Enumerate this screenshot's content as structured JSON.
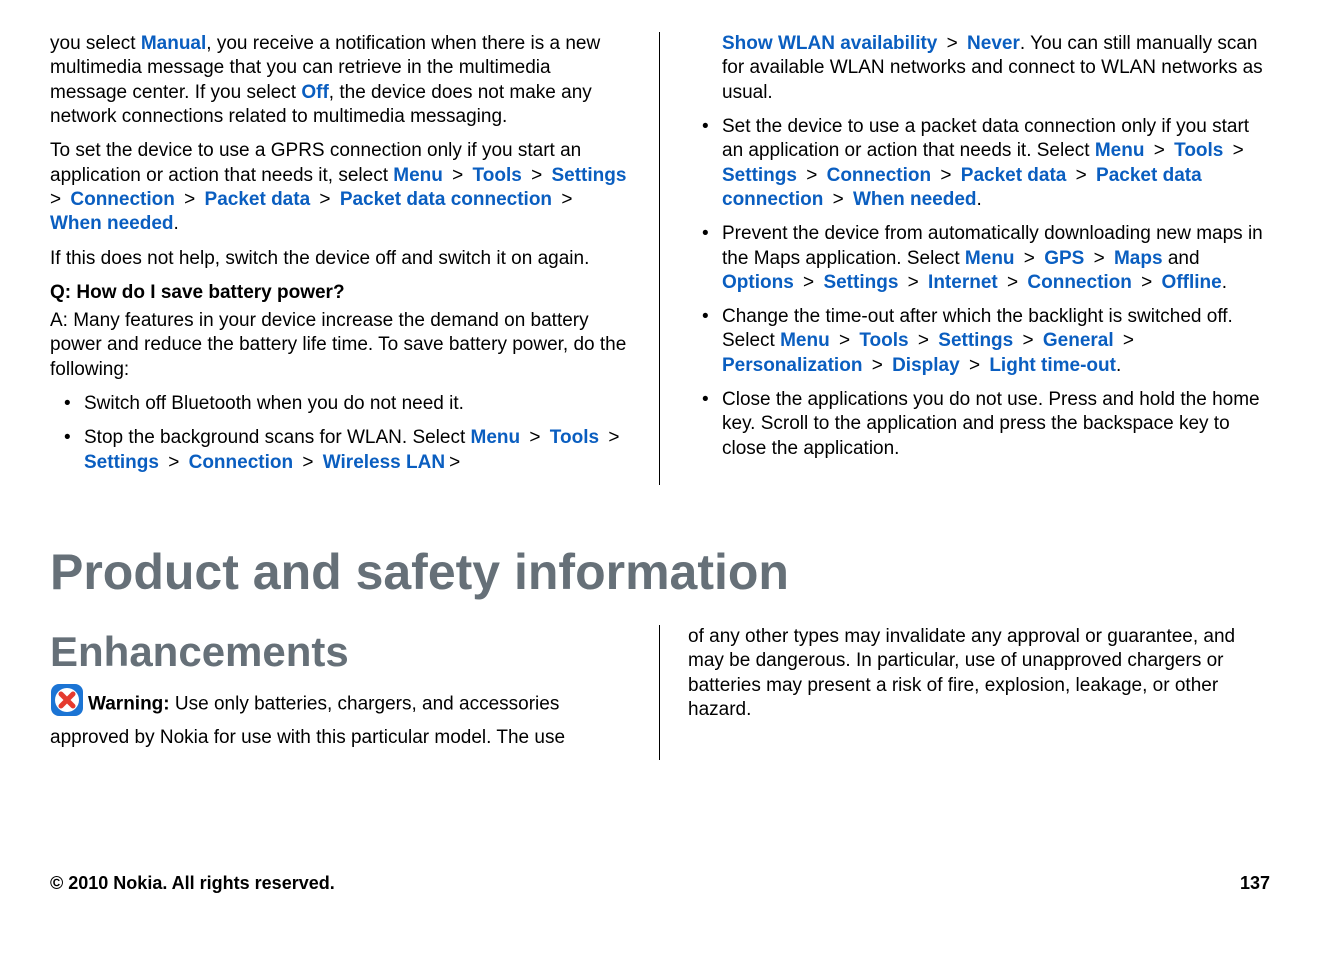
{
  "upper_left": {
    "p1_a": "you select ",
    "p1_manual": "Manual",
    "p1_b": ", you receive a notification when there is a new multimedia message that you can retrieve in the multimedia message center. If you select ",
    "p1_off": "Off",
    "p1_c": ", the device does not make any network connections related to multimedia messaging.",
    "p2_a": "To set the device to use a GPRS connection only if you start an application or action that needs it, select ",
    "p2_path": [
      "Menu",
      "Tools",
      "Settings",
      "Connection",
      "Packet data",
      "Packet data connection",
      "When needed"
    ],
    "p2_b": ".",
    "p3": "If this does not help, switch the device off and switch it on again.",
    "q": "Q: How do I save battery power?",
    "a": "A: Many features in your device increase the demand on battery power and reduce the battery life time. To save battery power, do the following:",
    "li1": "Switch off Bluetooth when you do not need it.",
    "li2_a": "Stop the background scans for WLAN. Select ",
    "li2_path": [
      "Menu",
      "Tools",
      "Settings",
      "Connection",
      "Wireless LAN"
    ]
  },
  "upper_right": {
    "cont_path": [
      "Show WLAN availability",
      "Never"
    ],
    "cont_b": ". You can still manually scan for available WLAN networks and connect to WLAN networks as usual.",
    "li3_a": "Set the device to use a packet data connection only if you start an application or action that needs it. Select ",
    "li3_path": [
      "Menu",
      "Tools",
      "Settings",
      "Connection",
      "Packet data",
      "Packet data connection",
      "When needed"
    ],
    "li3_b": ".",
    "li4_a": "Prevent the device from automatically downloading new maps in the Maps application. Select ",
    "li4_path1": [
      "Menu",
      "GPS",
      "Maps"
    ],
    "li4_and": " and ",
    "li4_path2": [
      "Options",
      "Settings",
      "Internet",
      "Connection",
      "Offline"
    ],
    "li4_b": ".",
    "li5_a": "Change the time-out after which the backlight is switched off. Select ",
    "li5_path": [
      "Menu",
      "Tools",
      "Settings",
      "General",
      "Personalization",
      "Display",
      "Light time-out"
    ],
    "li5_b": ".",
    "li6": "Close the applications you do not use. Press and hold the home key. Scroll to the application and press the backspace key to close the application."
  },
  "h1": "Product and safety information",
  "h2": "Enhancements",
  "lower_left": {
    "warn_label": "Warning:  ",
    "warn_text": "Use only batteries, chargers, and accessories approved by Nokia for use with this particular model. The use"
  },
  "lower_right": {
    "text": "of any other types may invalidate any approval or guarantee, and may be dangerous. In particular, use of unapproved chargers or batteries may present a risk of fire, explosion, leakage, or other hazard."
  },
  "footer": {
    "copyright": "© 2010 Nokia. All rights reserved.",
    "page": "137"
  }
}
